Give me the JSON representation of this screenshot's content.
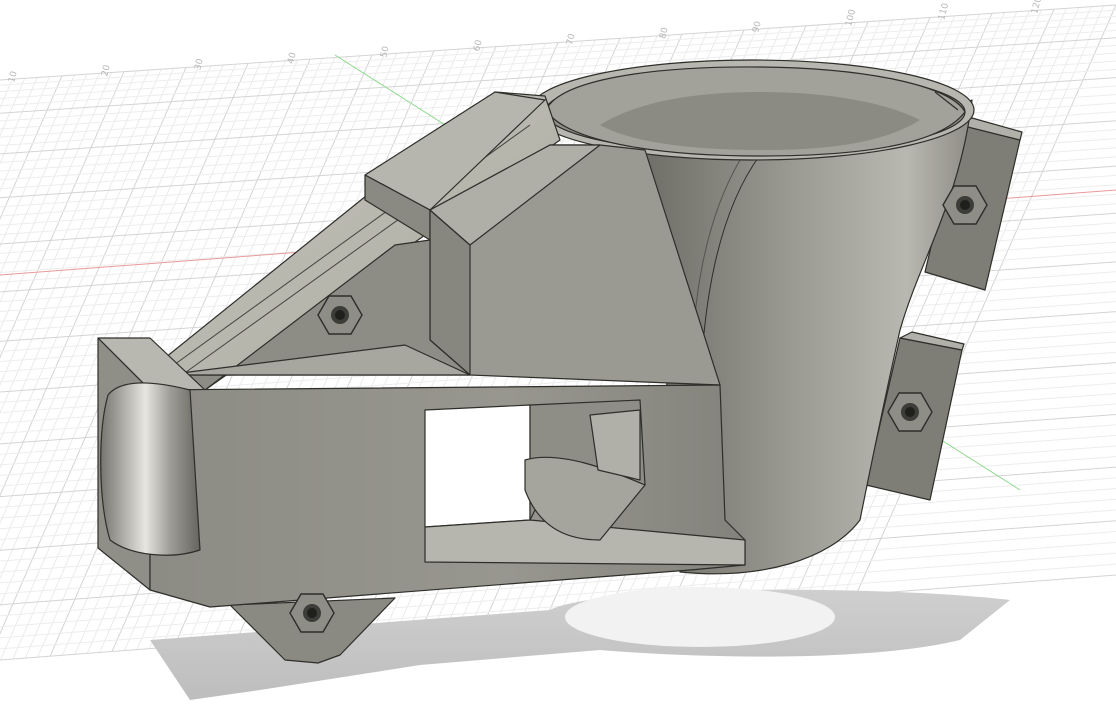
{
  "app": {
    "view": "3D model viewport",
    "model_color": "#a9a89f",
    "grid_color": "#d7d7d7",
    "x_axis_color": "#e87d7d",
    "y_axis_color": "#7fcf7f"
  },
  "grid": {
    "tick_labels": [
      "10",
      "20",
      "30",
      "40",
      "50",
      "60",
      "70",
      "80",
      "90",
      "100",
      "110",
      "120"
    ]
  },
  "hardware": {
    "nuts": [
      "hex-nut",
      "hex-nut",
      "hex-nut",
      "hex-nut"
    ]
  }
}
